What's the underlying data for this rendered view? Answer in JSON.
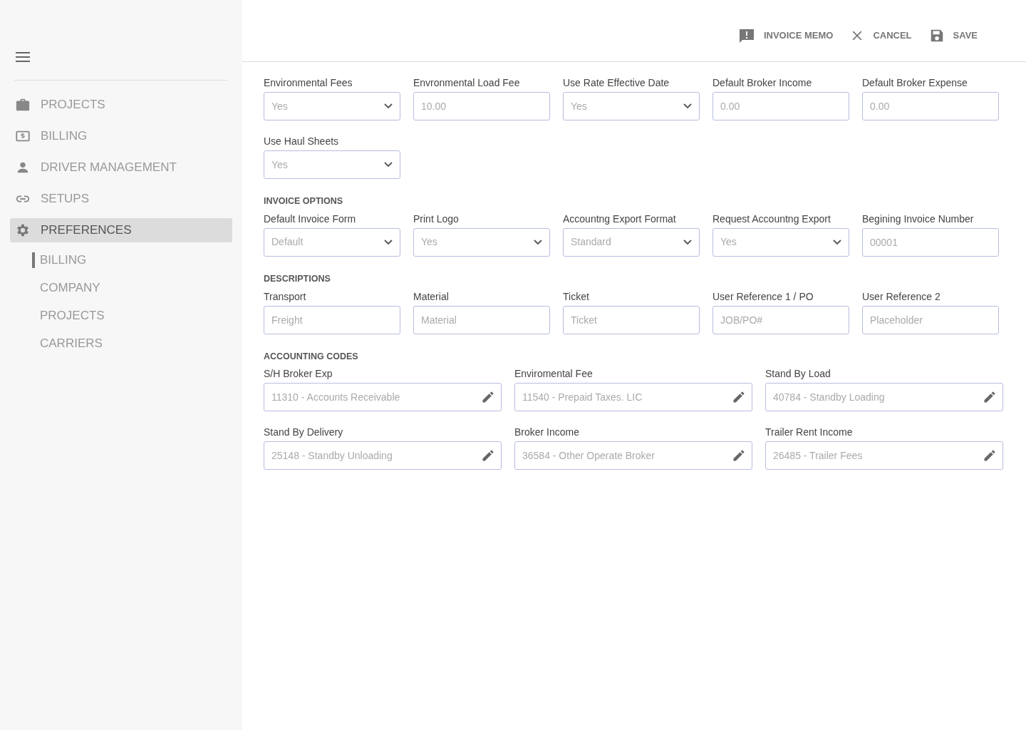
{
  "sidebar": {
    "items": [
      {
        "label": "PROJECTS",
        "kind": "briefcase",
        "selected": false
      },
      {
        "label": "BILLING",
        "kind": "money",
        "selected": false
      },
      {
        "label": "DRIVER MANAGEMENT",
        "kind": "person",
        "selected": false
      },
      {
        "label": "SETUPS",
        "kind": "link",
        "selected": false
      },
      {
        "label": "PREFERENCES",
        "kind": "gear",
        "selected": true,
        "children": [
          {
            "label": "BILLING",
            "selected": true
          },
          {
            "label": "COMPANY",
            "selected": false
          },
          {
            "label": "PROJECTS",
            "selected": false
          },
          {
            "label": "CARRIERS",
            "selected": false
          }
        ]
      }
    ]
  },
  "toolbar": {
    "buttons": [
      {
        "label": "INVOICE MEMO",
        "kind": "memo"
      },
      {
        "label": "CANCEL",
        "kind": "close"
      },
      {
        "label": "SAVE",
        "kind": "save"
      }
    ]
  },
  "sections": [
    {
      "fields": [
        {
          "kind": "select",
          "label": "Environmental Fees",
          "value": "Yes"
        },
        {
          "kind": "text",
          "label": "Envronmental Load Fee",
          "placeholder": "10.00"
        },
        {
          "kind": "select",
          "label": "Use Rate Effective Date",
          "value": "Yes"
        },
        {
          "kind": "text",
          "label": "Default Broker Income",
          "placeholder": "0.00"
        },
        {
          "kind": "text",
          "label": "Default Broker Expense",
          "placeholder": "0.00"
        },
        {
          "kind": "select",
          "label": "Use Haul Sheets",
          "value": "Yes"
        }
      ]
    },
    {
      "title": "INVOICE OPTIONS",
      "fields": [
        {
          "kind": "select",
          "label": "Default Invoice Form",
          "value": "Default"
        },
        {
          "kind": "select",
          "label": "Print Logo",
          "value": "Yes"
        },
        {
          "kind": "select",
          "label": "Accountng Export Format",
          "value": "Standard"
        },
        {
          "kind": "select",
          "label": "Request Accountng Export",
          "value": "Yes"
        },
        {
          "kind": "text",
          "label": "Begining Invoice Number",
          "placeholder": "00001"
        }
      ]
    },
    {
      "title": "DESCRIPTIONS",
      "fields": [
        {
          "kind": "text",
          "label": "Transport",
          "placeholder": "Freight"
        },
        {
          "kind": "text",
          "label": "Material",
          "placeholder": "Material"
        },
        {
          "kind": "text",
          "label": "Ticket",
          "placeholder": "Ticket"
        },
        {
          "kind": "text",
          "label": "User Reference 1 / PO",
          "placeholder": "JOB/PO#"
        },
        {
          "kind": "text",
          "label": "User Reference 2",
          "placeholder": "Placeholder"
        }
      ]
    },
    {
      "title": "ACCOUNTING CODES",
      "fields": [
        {
          "kind": "code",
          "label": "S/H Broker Exp",
          "value": "11310 - Accounts Receivable"
        },
        {
          "kind": "code",
          "label": "Enviromental Fee",
          "value": "11540 - Prepaid Taxes. LIC"
        },
        {
          "kind": "code",
          "label": "Stand By Load",
          "value": "40784 - Standby Loading"
        },
        {
          "kind": "code",
          "label": "Stand By Delivery",
          "value": "25148 - Standby Unloading"
        },
        {
          "kind": "code",
          "label": "Broker Income",
          "value": "36584 - Other Operate Broker"
        },
        {
          "kind": "code",
          "label": "Trailer Rent Income",
          "value": "26485 - Trailer Fees"
        }
      ]
    }
  ]
}
